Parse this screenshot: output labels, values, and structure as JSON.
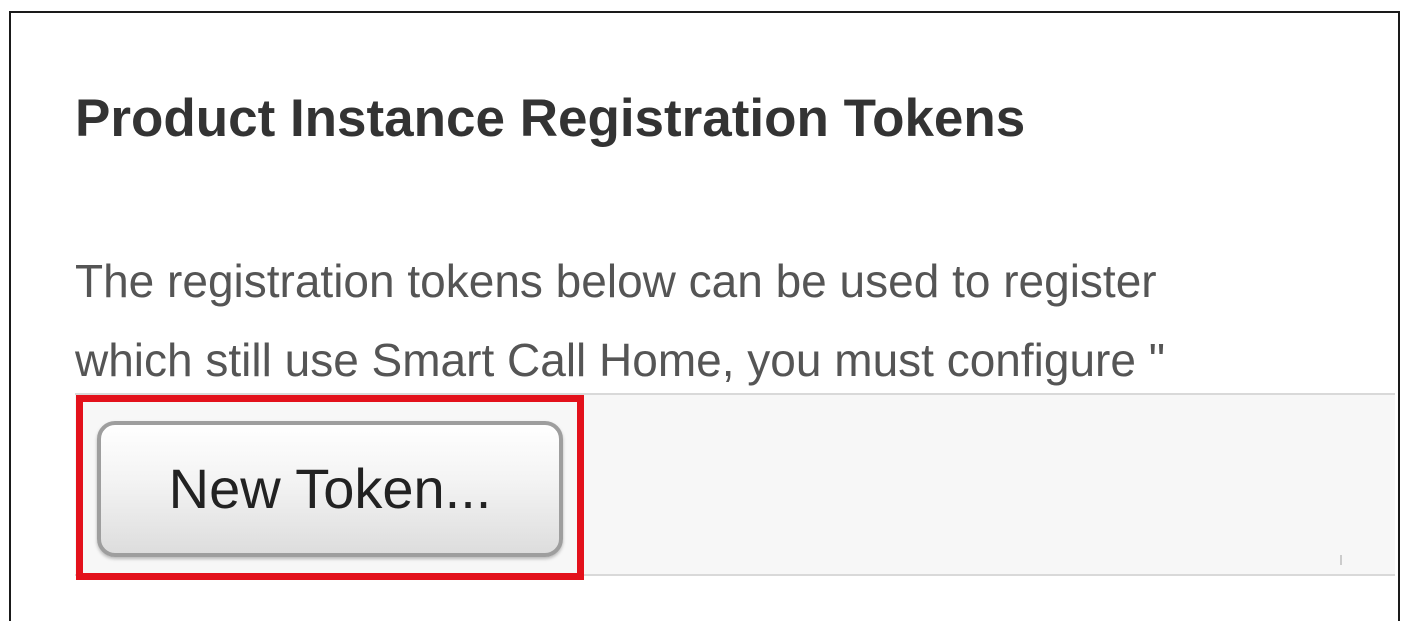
{
  "page": {
    "title": "Product Instance Registration Tokens",
    "description_lines": [
      "The registration tokens below can be used to register",
      "which still use Smart Call Home, you must configure \""
    ]
  },
  "toolbar": {
    "new_token_label": "New Token..."
  },
  "colors": {
    "highlight": "#e3111b",
    "title_text": "#333333",
    "body_text": "#555555",
    "toolbar_bg": "#f7f7f7"
  }
}
